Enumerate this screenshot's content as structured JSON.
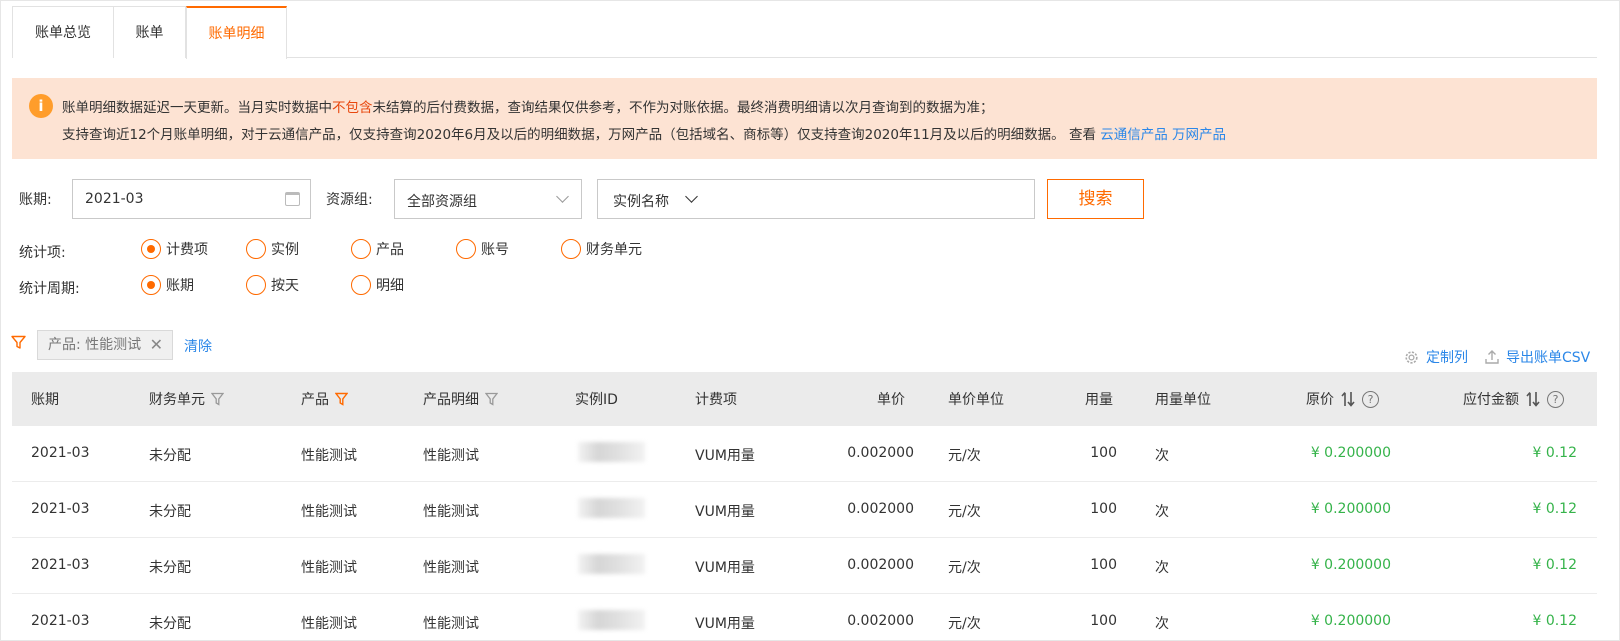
{
  "tabs": [
    {
      "label": "账单总览"
    },
    {
      "label": "账单"
    },
    {
      "label": "账单明细"
    }
  ],
  "notice": {
    "icon": "info-icon",
    "line1_a": "账单明细数据延迟一天更新。当月实时数据中",
    "line1_red": "不包含",
    "line1_b": "未结算的后付费数据，查询结果仅供参考，不作为对账依据。最终消费明细请以次月查询到的数据为准；",
    "line2": "支持查询近12个月账单明细，对于云通信产品，仅支持查询2020年6月及以后的明细数据，万网产品（包括域名、商标等）仅支持查询2020年11月及以后的明细数据。 查看",
    "link1": "云通信产品",
    "link2": "万网产品"
  },
  "search": {
    "period_label": "账期:",
    "period_value": "2021-03",
    "group_label": "资源组:",
    "group_value": "全部资源组",
    "instance_select": "实例名称",
    "search_button": "搜索"
  },
  "stat_items": {
    "label": "统计项:",
    "options": [
      "计费项",
      "实例",
      "产品",
      "账号",
      "财务单元"
    ],
    "selected": "计费项"
  },
  "stat_period": {
    "label": "统计周期:",
    "options": [
      "账期",
      "按天",
      "明细"
    ],
    "selected": "账期"
  },
  "filter": {
    "chip": "产品: 性能测试",
    "clear": "清除"
  },
  "tools": {
    "customize": "定制列",
    "export": "导出账单CSV"
  },
  "table": {
    "headers": [
      "账期",
      "财务单元",
      "产品",
      "产品明细",
      "实例ID",
      "计费项",
      "单价",
      "单价单位",
      "用量",
      "用量单位",
      "原价",
      "应付金额"
    ],
    "rows": [
      [
        "2021-03",
        "未分配",
        "性能测试",
        "性能测试",
        "",
        "VUM用量",
        "0.002000",
        "元/次",
        "100",
        "次",
        "¥ 0.200000",
        "¥ 0.12"
      ],
      [
        "2021-03",
        "未分配",
        "性能测试",
        "性能测试",
        "",
        "VUM用量",
        "0.002000",
        "元/次",
        "100",
        "次",
        "¥ 0.200000",
        "¥ 0.12"
      ],
      [
        "2021-03",
        "未分配",
        "性能测试",
        "性能测试",
        "",
        "VUM用量",
        "0.002000",
        "元/次",
        "100",
        "次",
        "¥ 0.200000",
        "¥ 0.12"
      ],
      [
        "2021-03",
        "未分配",
        "性能测试",
        "性能测试",
        "",
        "VUM用量",
        "0.002000",
        "元/次",
        "100",
        "次",
        "¥ 0.200000",
        "¥ 0.12"
      ]
    ]
  },
  "colors": {
    "accent": "#ff6a00",
    "link": "#2b87e8",
    "notice_bg": "#fde3d3",
    "amount_green": "#35b34a"
  }
}
